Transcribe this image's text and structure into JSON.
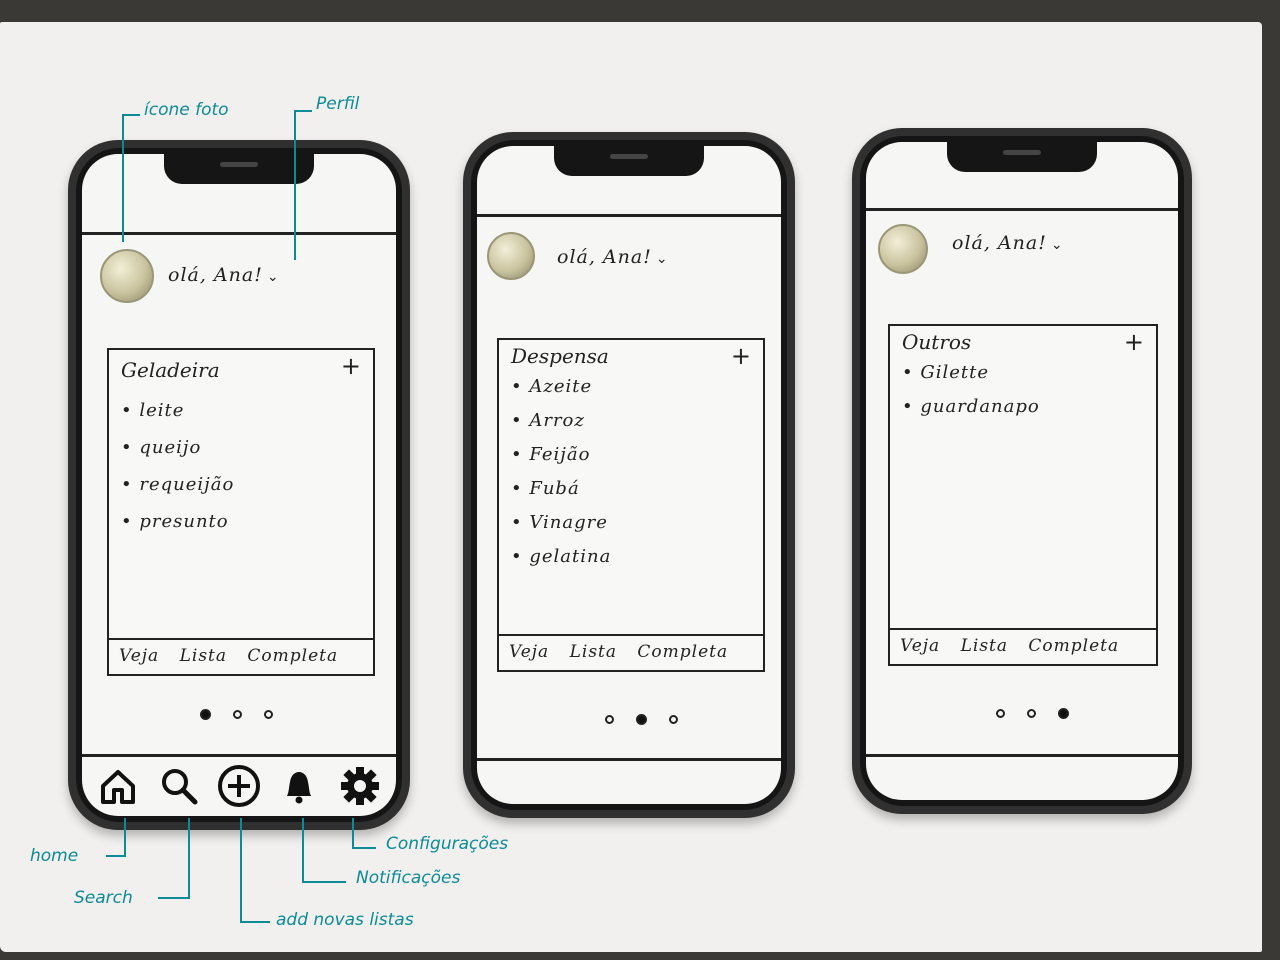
{
  "annotations": {
    "photo_icon": "ícone foto",
    "profile": "Perfil",
    "home": "home",
    "search": "Search",
    "add_lists": "add novas listas",
    "notifications": "Notificações",
    "settings": "Configurações"
  },
  "screens": [
    {
      "greeting": "olá, Ana!",
      "card": {
        "title": "Geladeira",
        "items": [
          "leite",
          "queijo",
          "requeijão",
          "presunto"
        ],
        "footer": "Veja Lista Completa"
      },
      "active_dot": 0
    },
    {
      "greeting": "olá, Ana!",
      "card": {
        "title": "Despensa",
        "items": [
          "Azeite",
          "Arroz",
          "Feijão",
          "Fubá",
          "Vinagre",
          "gelatina"
        ],
        "footer": "Veja Lista Completa"
      },
      "active_dot": 1
    },
    {
      "greeting": "olá, Ana!",
      "card": {
        "title": "Outros",
        "items": [
          "Gilette",
          "guardanapo"
        ],
        "footer": "Veja Lista Completa"
      },
      "active_dot": 2
    }
  ],
  "tabbar": [
    "home-icon",
    "search-icon",
    "add-circle-icon",
    "bell-icon",
    "gear-icon"
  ],
  "colors": {
    "annotation": "#0c8b96",
    "ink": "#222222",
    "paper": "#f1f0ee"
  }
}
